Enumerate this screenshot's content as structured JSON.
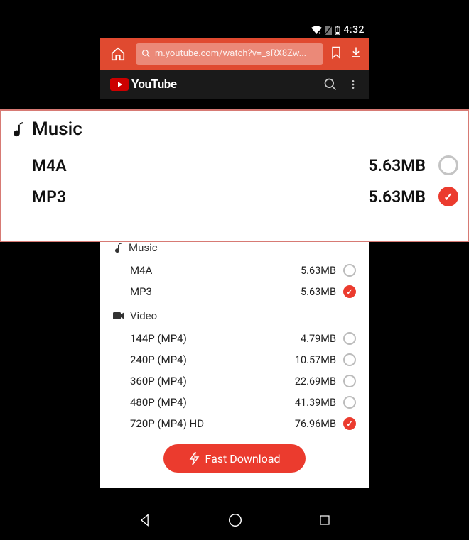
{
  "status": {
    "time": "4:32"
  },
  "url": "m.youtube.com/watch?v=_sRX8Zw...",
  "yt_label": "YouTube",
  "zoom": {
    "head": "Music",
    "rows": [
      {
        "label": "M4A",
        "size": "5.63MB",
        "on": false
      },
      {
        "label": "MP3",
        "size": "5.63MB",
        "on": true
      }
    ]
  },
  "sheet": {
    "music_head": "Music",
    "music": [
      {
        "label": "M4A",
        "size": "5.63MB",
        "on": false
      },
      {
        "label": "MP3",
        "size": "5.63MB",
        "on": true
      }
    ],
    "video_head": "Video",
    "video": [
      {
        "label": "144P  (MP4)",
        "size": "4.79MB",
        "on": false
      },
      {
        "label": "240P  (MP4)",
        "size": "10.57MB",
        "on": false
      },
      {
        "label": "360P  (MP4)",
        "size": "22.69MB",
        "on": false
      },
      {
        "label": "480P  (MP4)",
        "size": "41.39MB",
        "on": false
      },
      {
        "label": "720P  (MP4) HD",
        "size": "76.96MB",
        "on": true
      }
    ],
    "button": "Fast Download"
  }
}
